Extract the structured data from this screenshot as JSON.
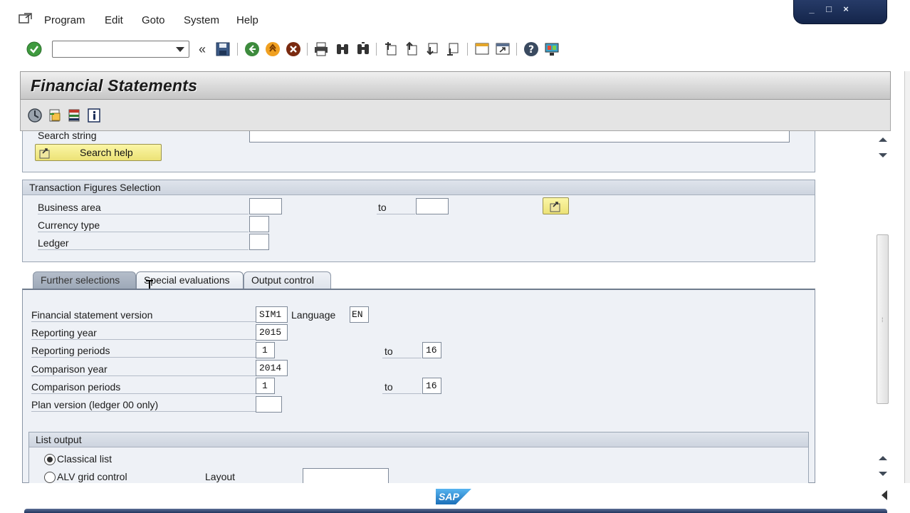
{
  "menubar": {
    "items": [
      "Program",
      "Edit",
      "Goto",
      "System",
      "Help"
    ]
  },
  "window_controls": {
    "minimize": "_",
    "maximize": "□",
    "close": "×"
  },
  "toolbar": {
    "command_field_value": "",
    "icons": [
      "enter-icon",
      "back-icon",
      "save-icon",
      "back-green-icon",
      "exit-icon",
      "cancel-icon",
      "print-icon",
      "find-icon",
      "find-next-icon",
      "first-page-icon",
      "previous-page-icon",
      "next-page-icon",
      "last-page-icon",
      "new-session-icon",
      "shortcut-icon",
      "help-icon",
      "customize-layout-icon"
    ]
  },
  "title": {
    "text": "Financial Statements"
  },
  "app_toolbar": {
    "icons": [
      "execute-icon",
      "get-variant-icon",
      "display-hierarchy-icon",
      "information-icon"
    ]
  },
  "search": {
    "label": "Search string",
    "value": "",
    "search_help_button": "Search help"
  },
  "transaction_figures": {
    "title": "Transaction Figures Selection",
    "business_area_label": "Business area",
    "to_label": "to",
    "currency_type_label": "Currency type",
    "ledger_label": "Ledger"
  },
  "tabs": [
    {
      "label": "Further selections",
      "active": true
    },
    {
      "label": "Special evaluations",
      "active": false
    },
    {
      "label": "Output control",
      "active": false
    }
  ],
  "special_evaluations": {
    "fs_version_label": "Financial statement version",
    "fs_version_value": "SIM1",
    "language_label": "Language",
    "language_value": "EN",
    "reporting_year_label": "Reporting year",
    "reporting_year_value": "2015",
    "reporting_periods_label": "Reporting periods",
    "reporting_periods_from": "1",
    "reporting_periods_to_label": "to",
    "reporting_periods_to": "16",
    "comparison_year_label": "Comparison year",
    "comparison_year_value": "2014",
    "comparison_periods_label": "Comparison periods",
    "comparison_periods_from": "1",
    "comparison_periods_to_label": "to",
    "comparison_periods_to": "16",
    "plan_version_label": "Plan version (ledger 00 only)",
    "plan_version_value": ""
  },
  "list_output": {
    "title": "List output",
    "classical_list": "Classical list",
    "alv_grid": "ALV grid control",
    "layout_label": "Layout",
    "layout_value": "",
    "selected": "classical_list"
  },
  "status": {
    "logo": "SAP"
  },
  "colors": {
    "title_bg": "#cfcfcf",
    "group_bg": "#eef1f6",
    "button_yellow": "#f3ec8b",
    "accent_dark_blue": "#1c2f5a"
  }
}
